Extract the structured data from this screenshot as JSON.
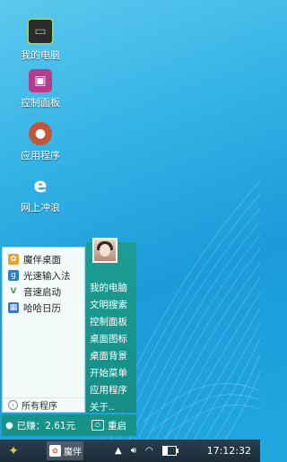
{
  "desktop": {
    "icons": [
      {
        "label": "我的电脑",
        "icon": "computer-icon"
      },
      {
        "label": "控制面板",
        "icon": "control-panel-icon"
      },
      {
        "label": "应用程序",
        "icon": "bear-app-icon"
      },
      {
        "label": "网上冲浪",
        "icon": "internet-explorer-icon"
      }
    ]
  },
  "start_menu": {
    "apps": [
      {
        "label": "魔伴桌面",
        "icon": "flower-icon",
        "color": "#e8a12b"
      },
      {
        "label": "光速输入法",
        "icon": "g-keyboard-icon",
        "color": "#2a7fd0"
      },
      {
        "label": "音速启动",
        "icon": "v-launch-icon",
        "color": "#3fa34d"
      },
      {
        "label": "哈哈日历",
        "icon": "calendar-icon",
        "color": "#3a74c9"
      }
    ],
    "all_programs": "所有程序",
    "right_items": [
      "我的电脑",
      "文明搜索",
      "控制面板",
      "桌面图标",
      "桌面背景",
      "开始菜单",
      "应用程序",
      "关于.."
    ],
    "earned": "已赚：2.61元",
    "restart": "重启"
  },
  "taskbar": {
    "task_label": "魔伴",
    "time": "17:12:32",
    "battery_level": 0.35
  },
  "colors": {
    "accent": "#1c9e94",
    "taskbar": "#1b2c38"
  }
}
